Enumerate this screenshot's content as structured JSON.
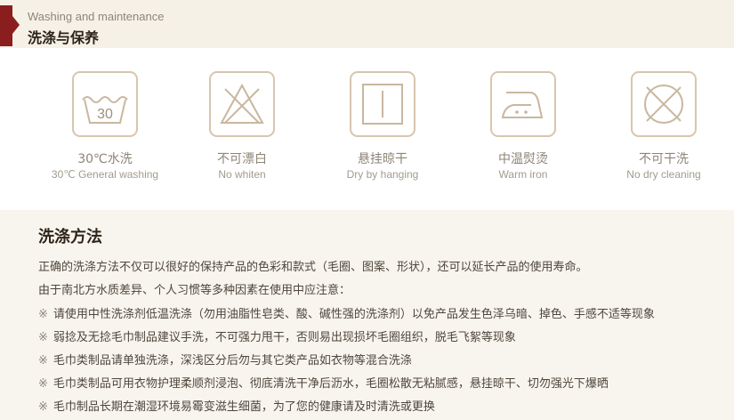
{
  "header": {
    "title_en": "Washing and maintenance",
    "title_zh": "洗涤与保养"
  },
  "care_icons": [
    {
      "icon": "wash-30-icon",
      "label_zh": "30℃水洗",
      "label_en": "30℃ General washing",
      "tub_text": "30"
    },
    {
      "icon": "no-bleach-icon",
      "label_zh": "不可漂白",
      "label_en": "No whiten"
    },
    {
      "icon": "hang-dry-icon",
      "label_zh": "悬挂晾干",
      "label_en": "Dry by hanging"
    },
    {
      "icon": "iron-medium-icon",
      "label_zh": "中温熨烫",
      "label_en": "Warm iron"
    },
    {
      "icon": "no-dry-clean-icon",
      "label_zh": "不可干洗",
      "label_en": "No dry cleaning"
    }
  ],
  "method": {
    "title": "洗涤方法",
    "intro": [
      "正确的洗涤方法不仅可以很好的保持产品的色彩和款式（毛圈、图案、形状），还可以延长产品的使用寿命。",
      "由于南北方水质差异、个人习惯等多种因素在使用中应注意："
    ],
    "bullet_mark": "※",
    "tips": [
      "请使用中性洗涤剂低温洗涤（勿用油脂性皂类、酸、碱性强的洗涤剂）以免产品发生色泽乌暗、掉色、手感不适等现象",
      "弱捻及无捻毛巾制品建议手洗，不可强力甩干，否则易出现损坏毛圈组织，脱毛飞絮等现象",
      "毛巾类制品请单独洗涤，深浅区分后勿与其它类产品如衣物等混合洗涤",
      "毛巾类制品可用衣物护理柔顺剂浸泡、彻底清洗干净后沥水，毛圈松散无粘腻感，悬挂晾干、切勿强光下爆晒",
      "毛巾制品长期在潮湿环境易霉变滋生细菌，为了您的健康请及时清洗或更换"
    ]
  },
  "colors": {
    "accent": "#8a1e1e",
    "icon_stroke": "#c8b79f",
    "label": "#8d8677"
  }
}
